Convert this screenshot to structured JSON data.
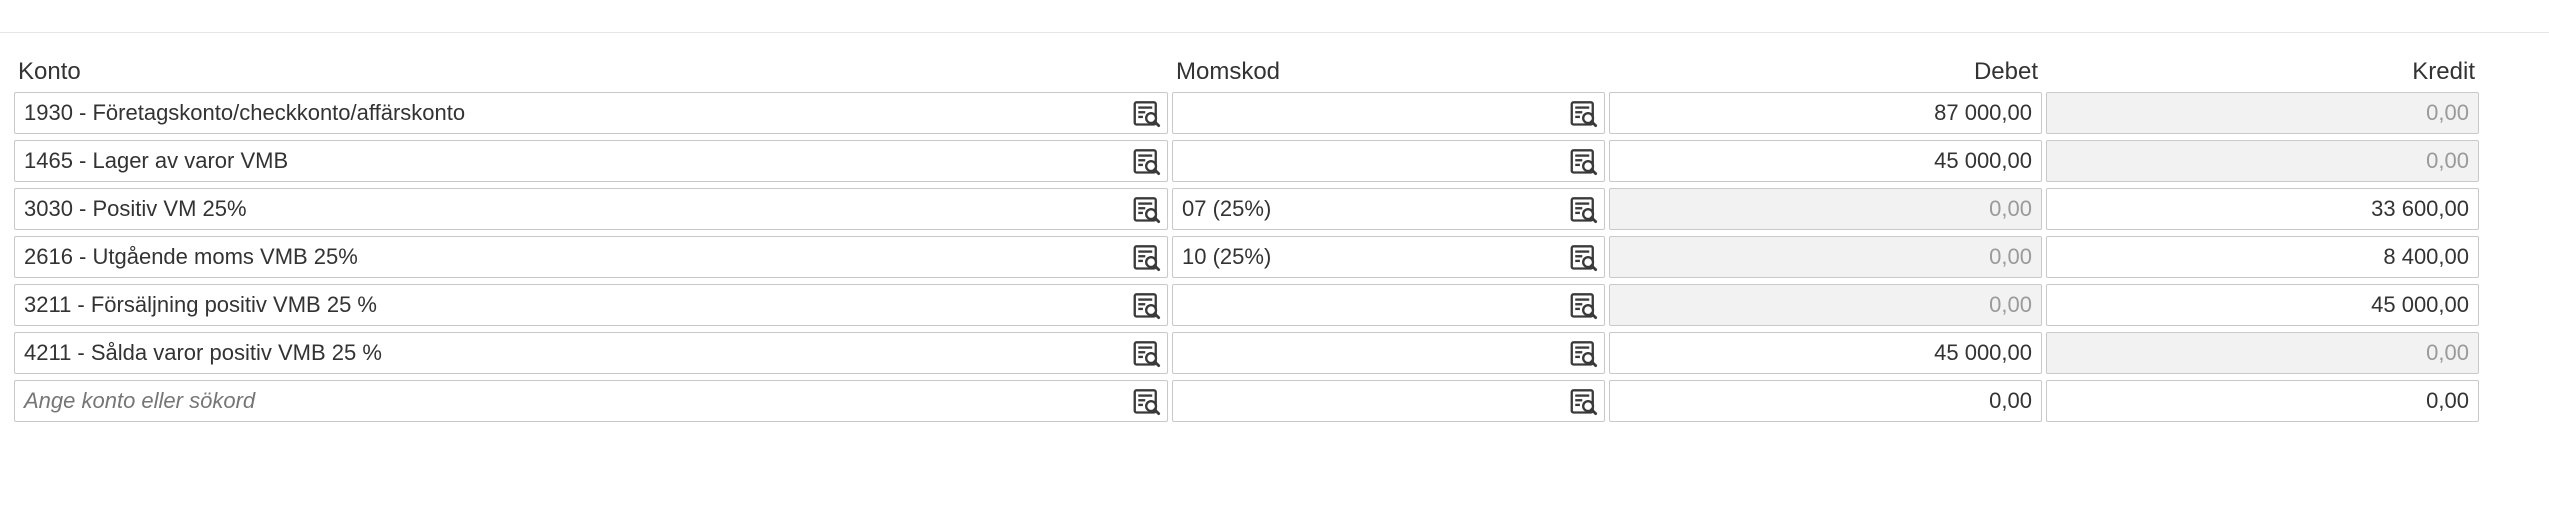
{
  "headers": {
    "konto": "Konto",
    "momskod": "Momskod",
    "debet": "Debet",
    "kredit": "Kredit"
  },
  "rows": [
    {
      "konto": "1930 - Företagskonto/checkkonto/affärskonto",
      "momskod": "",
      "debet": "87 000,00",
      "kredit": "0,00",
      "debet_disabled": false,
      "kredit_disabled": true
    },
    {
      "konto": "1465 - Lager av varor VMB",
      "momskod": "",
      "debet": "45 000,00",
      "kredit": "0,00",
      "debet_disabled": false,
      "kredit_disabled": true
    },
    {
      "konto": "3030 - Positiv VM 25%",
      "momskod": "07 (25%)",
      "debet": "0,00",
      "kredit": "33 600,00",
      "debet_disabled": true,
      "kredit_disabled": false
    },
    {
      "konto": "2616 - Utgående moms VMB 25%",
      "momskod": "10 (25%)",
      "debet": "0,00",
      "kredit": "8 400,00",
      "debet_disabled": true,
      "kredit_disabled": false
    },
    {
      "konto": "3211 - Försäljning positiv VMB 25 %",
      "momskod": "",
      "debet": "0,00",
      "kredit": "45 000,00",
      "debet_disabled": true,
      "kredit_disabled": false
    },
    {
      "konto": "4211 - Sålda varor positiv VMB 25 %",
      "momskod": "",
      "debet": "45 000,00",
      "kredit": "0,00",
      "debet_disabled": false,
      "kredit_disabled": true
    }
  ],
  "new_row": {
    "konto_placeholder": "Ange konto eller sökord",
    "debet": "0,00",
    "kredit": "0,00"
  },
  "icons": {
    "lookup": "search-list-icon"
  },
  "colors": {
    "border": "#c9c9c9",
    "disabled_bg": "#f2f2f2",
    "disabled_text": "#9a9a9a",
    "text": "#333333"
  }
}
